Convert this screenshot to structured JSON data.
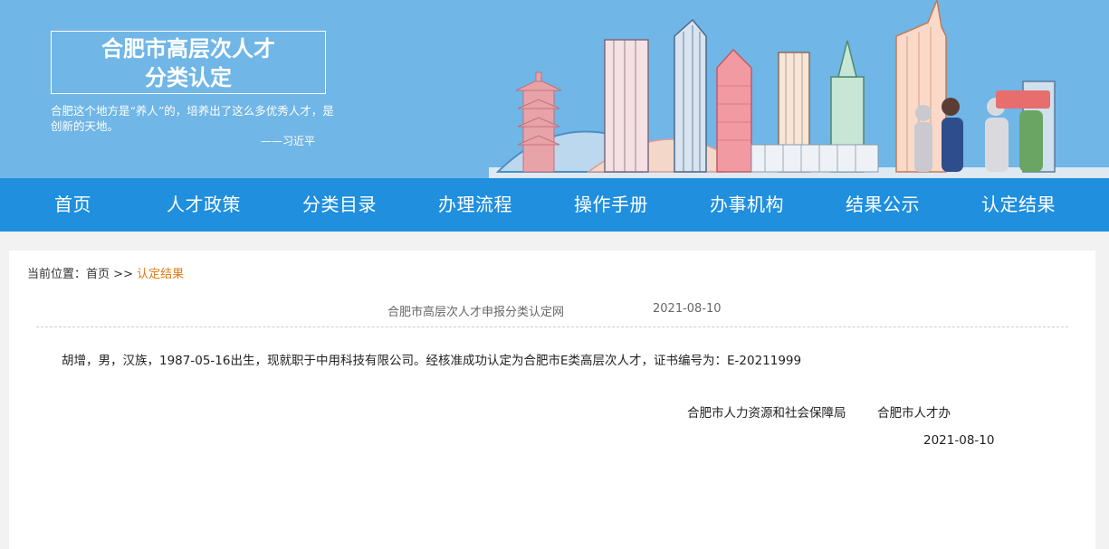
{
  "banner": {
    "title_line1": "合肥市高层次人才",
    "title_line2": "分类认定",
    "quote": "合肥这个地方是“养人”的，培养出了这么多优秀人才，是创新的天地。",
    "quote_author": "——习近平"
  },
  "nav": {
    "items": [
      "首页",
      "人才政策",
      "分类目录",
      "办理流程",
      "操作手册",
      "办事机构",
      "结果公示",
      "认定结果"
    ]
  },
  "breadcrumb": {
    "prefix": "当前位置：",
    "home": "首页",
    "sep": ">>",
    "current": "认定结果"
  },
  "article": {
    "source": "合肥市高层次人才申报分类认定网",
    "date": "2021-08-10",
    "body": "胡增，男，汉族，1987-05-16出生，现就职于中用科技有限公司。经核准成功认定为合肥市E类高层次人才，证书编号为：E-20211999",
    "signer1": "合肥市人力资源和社会保障局",
    "signer2": "合肥市人才办",
    "sign_date": "2021-08-10"
  }
}
